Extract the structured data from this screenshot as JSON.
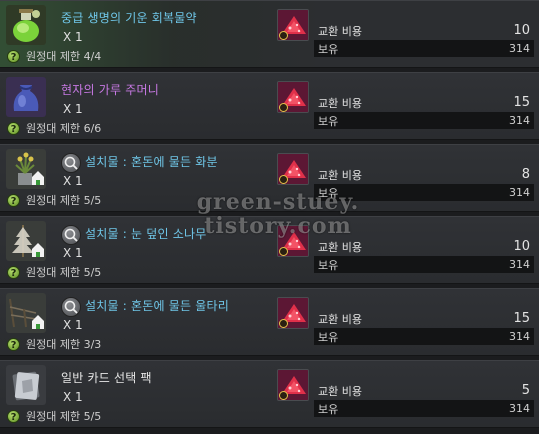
{
  "items": [
    {
      "name": "중급 생명의 기운 회복물약",
      "name_color": "cyan",
      "icon": "green-potion-icon",
      "has_search": false,
      "qty": "X 1",
      "limit": "원정대 제한 4/4",
      "cost_label": "교환 비용",
      "cost_value": "10",
      "owned_label": "보유",
      "owned_value": "314",
      "highlight": true
    },
    {
      "name": "현자의 가루 주머니",
      "name_color": "purple",
      "icon": "powder-pouch-icon",
      "has_search": false,
      "qty": "X 1",
      "limit": "원정대 제한 6/6",
      "cost_label": "교환 비용",
      "cost_value": "15",
      "owned_label": "보유",
      "owned_value": "314",
      "highlight": false
    },
    {
      "name": "설치물 : 혼돈에 물든 화분",
      "name_color": "cyan",
      "icon": "flower-pot-icon",
      "has_search": true,
      "qty": "X 1",
      "limit": "원정대 제한 5/5",
      "cost_label": "교환 비용",
      "cost_value": "8",
      "owned_label": "보유",
      "owned_value": "314",
      "highlight": false
    },
    {
      "name": "설치물 : 눈 덮인 소나무",
      "name_color": "cyan",
      "icon": "snowy-pine-icon",
      "has_search": true,
      "qty": "X 1",
      "limit": "원정대 제한 5/5",
      "cost_label": "교환 비용",
      "cost_value": "10",
      "owned_label": "보유",
      "owned_value": "314",
      "highlight": false
    },
    {
      "name": "설치물 : 혼돈에 물든 울타리",
      "name_color": "cyan",
      "icon": "fence-icon",
      "has_search": true,
      "qty": "X 1",
      "limit": "원정대 제한 3/3",
      "cost_label": "교환 비용",
      "cost_value": "15",
      "owned_label": "보유",
      "owned_value": "314",
      "highlight": false
    },
    {
      "name": "일반 카드 선택 팩",
      "name_color": "white",
      "icon": "card-pack-icon",
      "has_search": false,
      "qty": "X 1",
      "limit": "원정대 제한 5/5",
      "cost_label": "교환 비용",
      "cost_value": "5",
      "owned_label": "보유",
      "owned_value": "314",
      "highlight": false
    }
  ],
  "currency_icon": "red-crystal-currency-icon",
  "watermark": "green-stuey.\ntistory.com"
}
